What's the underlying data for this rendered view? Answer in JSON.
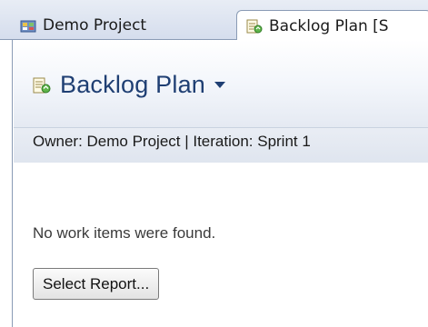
{
  "tabs": [
    {
      "label": "Demo Project",
      "icon": "project-icon",
      "active": false
    },
    {
      "label": "Backlog Plan [S",
      "icon": "plan-icon",
      "active": true
    }
  ],
  "header": {
    "title": "Backlog Plan",
    "icon": "plan-icon"
  },
  "owner_line": "Owner: Demo Project | Iteration: Sprint 1",
  "message": "No work items were found.",
  "select_report_button": "Select Report...",
  "colors": {
    "title": "#1f3f73",
    "border": "#8a9bb5"
  }
}
